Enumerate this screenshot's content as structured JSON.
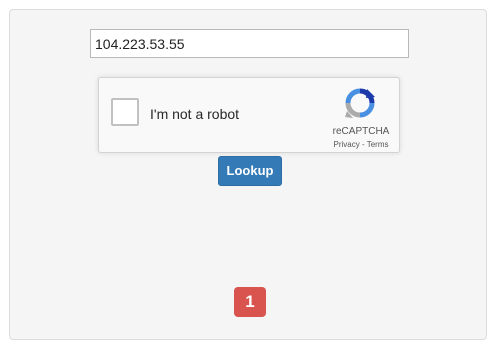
{
  "form": {
    "ip_value": "104.223.53.55",
    "lookup_label": "Lookup"
  },
  "recaptcha": {
    "label": "I'm not a robot",
    "brand": "reCAPTCHA",
    "privacy": "Privacy",
    "separator": " - ",
    "terms": "Terms",
    "checked": false
  },
  "badge": {
    "count": "1"
  },
  "colors": {
    "panel_bg": "#f5f5f5",
    "button_primary": "#337ab7",
    "badge_danger": "#d9534f"
  }
}
